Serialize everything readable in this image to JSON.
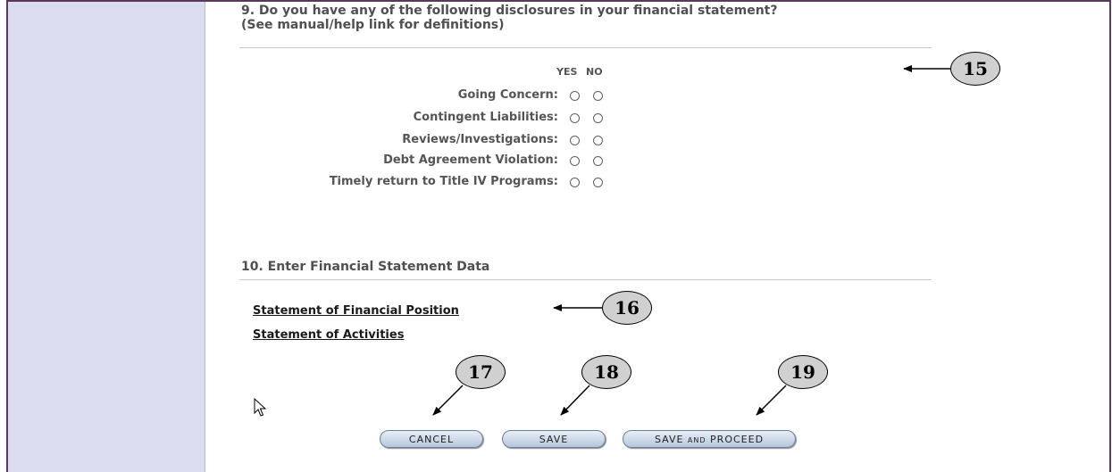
{
  "question9": {
    "heading_line1": "9. Do you have any of the following disclosures in your financial statement?",
    "heading_line2": "(See manual/help link for definitions)",
    "col_yes": "YES",
    "col_no": "NO",
    "rows": [
      {
        "label": "Going Concern:"
      },
      {
        "label": "Contingent Liabilities:"
      },
      {
        "label": "Reviews/Investigations:"
      },
      {
        "label": "Debt Agreement Violation:"
      },
      {
        "label": "Timely return to Title IV Programs:"
      }
    ]
  },
  "question10": {
    "heading": "10. Enter Financial Statement Data",
    "links": [
      {
        "label": "Statement of Financial Position"
      },
      {
        "label": "Statement of Activities"
      }
    ]
  },
  "buttons": {
    "cancel": "CANCEL",
    "save": "SAVE",
    "save_proceed_main": "SAVE",
    "save_proceed_and": "AND",
    "save_proceed_rest": "PROCEED"
  },
  "callouts": {
    "c15": "15",
    "c16": "16",
    "c17": "17",
    "c18": "18",
    "c19": "19"
  },
  "icons": {
    "pointer": "mouse-pointer-icon"
  }
}
